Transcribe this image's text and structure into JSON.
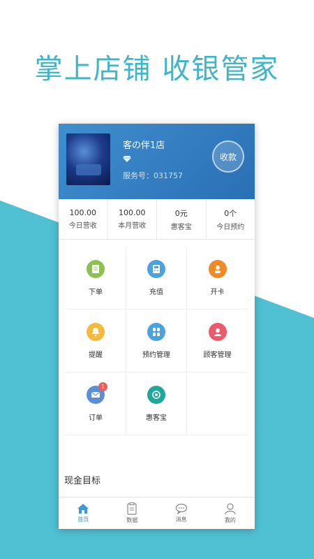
{
  "headline": "掌上店铺  收银管家",
  "shop": {
    "name": "客の伴1店",
    "service_no": "服务号：031757",
    "collect_label": "收款"
  },
  "stats": [
    {
      "value": "100.00",
      "label": "今日营收"
    },
    {
      "value": "100.00",
      "label": "本月营收"
    },
    {
      "value": "0元",
      "label": "惠客宝"
    },
    {
      "value": "0个",
      "label": "今日预约"
    }
  ],
  "menu": [
    {
      "label": "下单",
      "icon": "order-form-icon",
      "color": "#8cc152"
    },
    {
      "label": "充值",
      "icon": "calculator-icon",
      "color": "#4aa3df"
    },
    {
      "label": "开卡",
      "icon": "card-person-icon",
      "color": "#f08a24"
    },
    {
      "label": "提醒",
      "icon": "bell-icon",
      "color": "#f6b93b"
    },
    {
      "label": "预约管理",
      "icon": "schedule-icon",
      "color": "#4aa3df"
    },
    {
      "label": "顾客管理",
      "icon": "customer-icon",
      "color": "#ec5b6b"
    },
    {
      "label": "订单",
      "icon": "envelope-icon",
      "color": "#5a8fd8",
      "badge": "1"
    },
    {
      "label": "惠客宝",
      "icon": "target-icon",
      "color": "#1fa79b"
    }
  ],
  "section_title": "现金目标",
  "tabs": [
    {
      "label": "首页",
      "icon": "home-icon"
    },
    {
      "label": "数据",
      "icon": "clipboard-icon"
    },
    {
      "label": "消息",
      "icon": "chat-icon"
    },
    {
      "label": "我的",
      "icon": "user-icon"
    }
  ],
  "colors": {
    "brand_teal": "#3fb6c6",
    "header_blue": "#2f7fc4",
    "tab_active": "#3a9ad9"
  }
}
